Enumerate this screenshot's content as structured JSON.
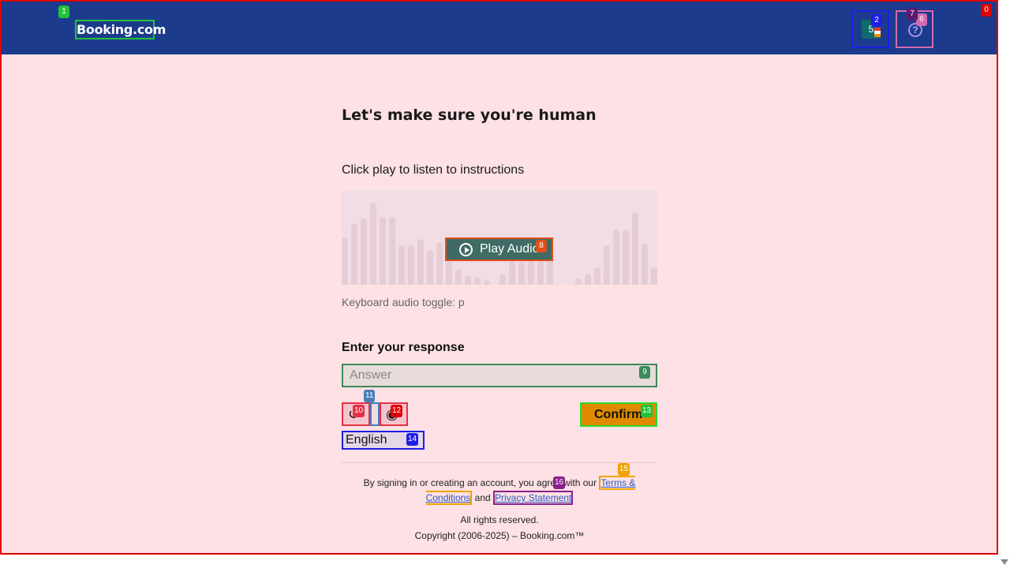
{
  "header": {
    "logo_text": "Booking.com",
    "flag_badge": "5",
    "help_glyph": "?"
  },
  "tags": [
    "0",
    "1",
    "2",
    "5",
    "6",
    "7",
    "8",
    "9",
    "10",
    "11",
    "12",
    "13",
    "14",
    "15",
    "16"
  ],
  "captcha": {
    "title": "Let's make sure you're human",
    "instructions": "Click play to listen to instructions",
    "play_label": "Play Audio",
    "toggle_hint": "Keyboard audio toggle: p",
    "response_label": "Enter your response",
    "answer_placeholder": "Answer",
    "confirm_label": "Confirm",
    "language": "English"
  },
  "footer": {
    "legal_prefix": "By signing in or creating an account, you agree with our",
    "terms_link": "Terms & Conditions",
    "and_text": "and",
    "privacy_link": "Privacy Statement",
    "rights": "All rights reserved.",
    "copyright": "Copyright (2006-2025) – Booking.com™"
  },
  "colors": {
    "header_bg": "#1c3b8c",
    "page_bg": "#fde1e4",
    "play_button": "#3f6b64",
    "confirm_button": "#e08a00"
  },
  "icons": [
    "globe-flag-icon",
    "help-icon",
    "play-circle-icon",
    "reload-icon",
    "eye-icon"
  ]
}
